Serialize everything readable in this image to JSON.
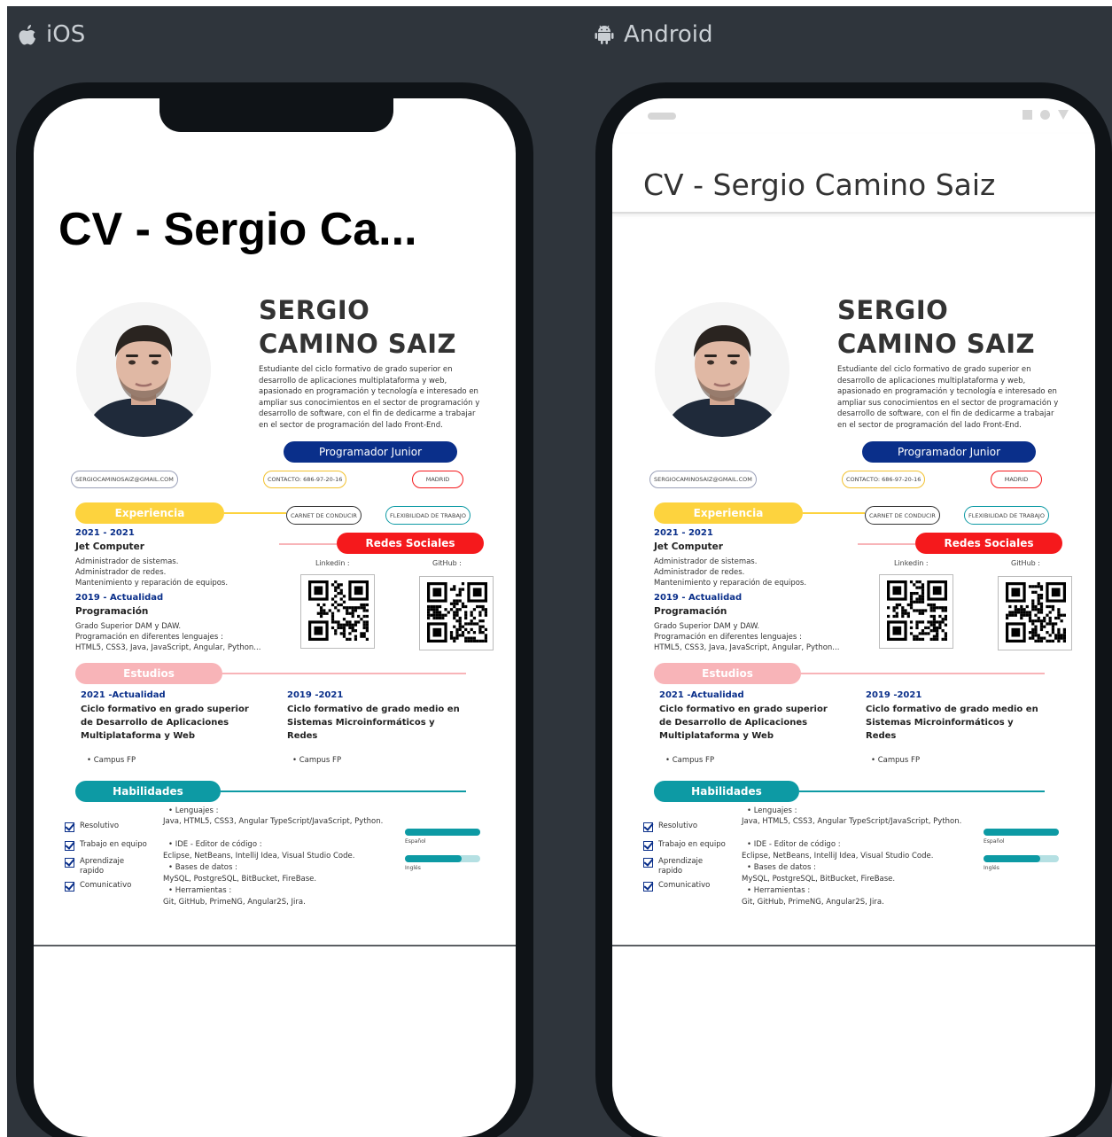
{
  "platforms": {
    "ios_label": "iOS",
    "android_label": "Android"
  },
  "ios": {
    "title": "CV - Sergio Ca..."
  },
  "android": {
    "title": "CV - Sergio Camino Saiz"
  },
  "cv": {
    "name_line1": "SERGIO",
    "name_line2": "CAMINO SAIZ",
    "bio": "Estudiante del ciclo formativo de grado superior en desarrollo de aplicaciones multiplataforma y web, apasionado en programación y tecnología e interesado en ampliar sus conocimientos en el sector de programación y desarrollo de software, con el fin de dedicarme a trabajar en el sector de programación del lado Front-End.",
    "job_title": "Programador Junior",
    "email": "SERGIOCAMINOSAIZ@GMAIL.COM",
    "contact": "CONTACTO: 686-97-20-16",
    "city": "MADRID",
    "license": "CARNET DE CONDUCIR",
    "flexibility": "FLEXIBILIDAD DE TRABAJO",
    "sections": {
      "experience": "Experiencia",
      "social": "Redes Sociales",
      "studies": "Estudios",
      "skills": "Habilidades"
    },
    "colors": {
      "experience": "#fdd33e",
      "social": "#f5191c",
      "studies": "#f8b4b8",
      "skills": "#0d9aa4",
      "navy": "#0a2f8a"
    },
    "experience": [
      {
        "date": "2021 - 2021",
        "role": "Jet Computer",
        "lines": [
          "Administrador de sistemas.",
          "Administrador de redes.",
          "Mantenimiento y reparación de equipos."
        ]
      },
      {
        "date": "2019 - Actualidad",
        "role": "Programación",
        "lines": [
          "Grado Superior DAM y DAW.",
          "Programación en diferentes lenguajes :",
          "HTML5, CSS3, Java, JavaScript, Angular, Python..."
        ]
      }
    ],
    "social": {
      "linkedin_label": "Linkedin :",
      "github_label": "GitHub :"
    },
    "studies": [
      {
        "date": "2021 -Actualidad",
        "title": "Ciclo formativo en grado superior de Desarrollo de Aplicaciones Multiplataforma y Web",
        "place": "Campus FP"
      },
      {
        "date": "2019 -2021",
        "title": "Ciclo formativo de grado medio en Sistemas Microinformáticos y Redes",
        "place": "Campus FP"
      }
    ],
    "soft_skills": [
      "Resolutivo",
      "Trabajo en equipo",
      "Aprendizaje rapido",
      "Comunicativo"
    ],
    "tech": {
      "lang_head": "Lenguajes :",
      "lang_list": "Java, HTML5, CSS3, Angular TypeScript/JavaScript, Python.",
      "ide_head": "IDE - Editor de código :",
      "ide_list": "Eclipse, NetBeans, IntelliJ Idea, Visual Studio Code.",
      "db_head": "Bases de datos :",
      "db_list": "MySQL, PostgreSQL, BitBucket, FireBase.",
      "tools_head": "Herramientas :",
      "tools_list": "Git, GitHub, PrimeNG, Angular2S, Jira."
    },
    "languages": [
      {
        "name": "Español",
        "level": 1.0
      },
      {
        "name": "Inglés",
        "level": 0.75
      }
    ]
  }
}
